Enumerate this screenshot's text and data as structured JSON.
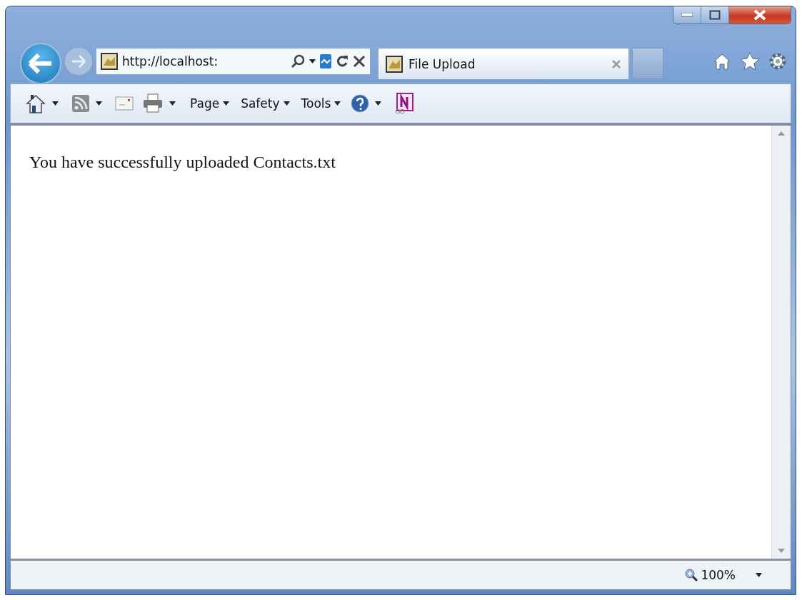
{
  "address_bar": {
    "value": "http://localhost:"
  },
  "tabs": [
    {
      "label": "File Upload",
      "selected": true
    }
  ],
  "toolbar": [
    {
      "kind": "home"
    },
    {
      "kind": "feeds"
    },
    {
      "kind": "mail"
    },
    {
      "kind": "print"
    },
    {
      "kind": "menu",
      "label": "Page"
    },
    {
      "kind": "menu",
      "label": "Safety"
    },
    {
      "kind": "menu",
      "label": "Tools"
    },
    {
      "kind": "help"
    },
    {
      "kind": "onenote"
    }
  ],
  "page": {
    "message": "You have successfully uploaded Contacts.txt"
  },
  "status_bar": {
    "zoom": "100%"
  }
}
